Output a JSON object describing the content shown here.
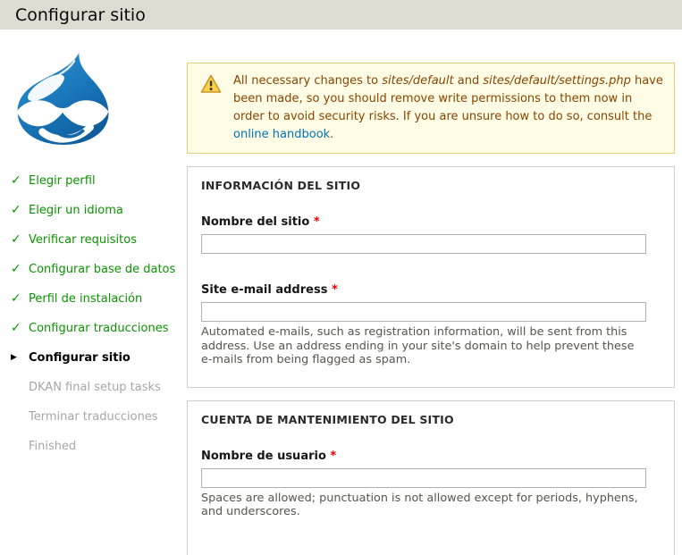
{
  "header": {
    "title": "Configurar sitio"
  },
  "sidebar": {
    "check_glyph": "✓",
    "active_glyph": "▶",
    "items": [
      {
        "label": "Elegir perfil",
        "state": "done"
      },
      {
        "label": "Elegir un idioma",
        "state": "done"
      },
      {
        "label": "Verificar requisitos",
        "state": "done"
      },
      {
        "label": "Configurar base de datos",
        "state": "done"
      },
      {
        "label": "Perfil de instalación",
        "state": "done"
      },
      {
        "label": "Configurar traducciones",
        "state": "done"
      },
      {
        "label": "Configurar sitio",
        "state": "active"
      },
      {
        "label": "DKAN final setup tasks",
        "state": "upcoming"
      },
      {
        "label": "Terminar traducciones",
        "state": "upcoming"
      },
      {
        "label": "Finished",
        "state": "upcoming"
      }
    ]
  },
  "warning": {
    "icon": "warning-triangle-icon",
    "text_before_path1": "All necessary changes to ",
    "path1": "sites/default",
    "text_between_paths": " and ",
    "path2": "sites/default/settings.php",
    "text_after_paths": " have been made, so you should remove write permissions to them now in order to avoid security risks. If you are unsure how to do so, consult the ",
    "link_text": "online handbook",
    "text_end": "."
  },
  "form": {
    "required_marker": "*",
    "sections": [
      {
        "legend": "INFORMACIÓN DEL SITIO",
        "fields": [
          {
            "label": "Nombre del sitio",
            "value": "",
            "description": ""
          },
          {
            "label": "Site e-mail address",
            "value": "",
            "description": "Automated e-mails, such as registration information, will be sent from this address. Use an address ending in your site's domain to help prevent these e-mails from being flagged as spam."
          }
        ]
      },
      {
        "legend": "CUENTA DE MANTENIMIENTO DEL SITIO",
        "fields": [
          {
            "label": "Nombre de usuario",
            "value": "",
            "description": "Spaces are allowed; punctuation is not allowed except for periods, hyphens, and underscores."
          }
        ]
      }
    ]
  },
  "colors": {
    "header_bg": "#dedbd2",
    "done_green": "#0a9400",
    "upcoming_gray": "#a6a6a6",
    "warning_bg": "#fffce5",
    "warning_border": "#e0d077",
    "warning_text": "#884400",
    "link_blue": "#0073b5",
    "required_red": "#e60000",
    "drupal_blue": "#1a78bb"
  }
}
